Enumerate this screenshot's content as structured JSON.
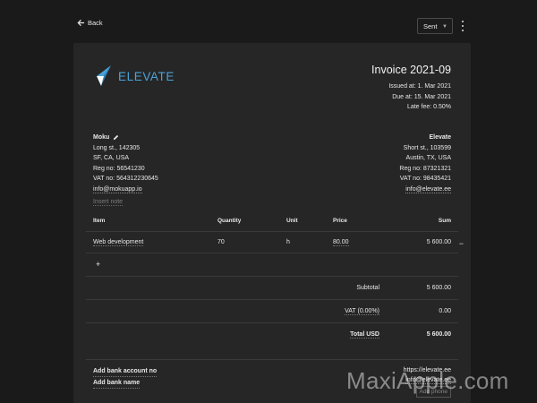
{
  "topbar": {
    "back_label": "Back",
    "status_value": "Sent"
  },
  "brand": {
    "logo_text": "ELEVATE",
    "color": "#4aa3d8"
  },
  "invoice": {
    "title": "Invoice 2021-09",
    "issued": "Issued at: 1. Mar 2021",
    "due": "Due at: 15. Mar 2021",
    "late_fee": "Late fee: 0.50%"
  },
  "client": {
    "name": "Moku",
    "address1": "Long st., 142305",
    "address2": "SF, CA, USA",
    "reg": "Reg no: 56541230",
    "vat": "VAT no: 564312230645",
    "email": "info@mokuapp.io"
  },
  "company": {
    "name": "Elevate",
    "address1": "Short st., 103599",
    "address2": "Austin, TX, USA",
    "reg": "Reg no: 87321321",
    "vat": "VAT no: 98435421",
    "email": "info@elevate.ee"
  },
  "insert_note": "Insert note",
  "table": {
    "headers": {
      "item": "Item",
      "quantity": "Quantity",
      "unit": "Unit",
      "price": "Price",
      "sum": "Sum"
    },
    "rows": [
      {
        "item": "Web development",
        "quantity": "70",
        "unit": "h",
        "price": "80.00",
        "sum": "5 600.00"
      }
    ],
    "remove_symbol": "−",
    "add_symbol": "+"
  },
  "totals": {
    "subtotal_label": "Subtotal",
    "subtotal_value": "5 600.00",
    "vat_label": "VAT (0.00%)",
    "vat_value": "0.00",
    "total_label": "Total USD",
    "total_value": "5 600.00"
  },
  "footer": {
    "add_bank": "Add bank account no",
    "add_bank_name": "Add bank name",
    "website": "https://elevate.ee",
    "email": "info@elevate.ee",
    "add_phone": "Add phone"
  },
  "watermark": "MaxiApple.com"
}
